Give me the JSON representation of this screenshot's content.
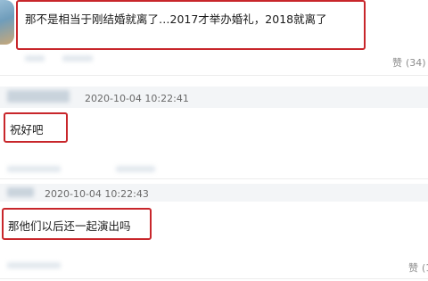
{
  "comments": [
    {
      "text": "那不是相当于刚结婚就离了…2017才举办婚礼，2018就离了",
      "like_icon": "thumbs-up-icon",
      "like_label": "赞",
      "like_count": "(34)"
    },
    {
      "timestamp": "2020-10-04  10:22:41",
      "text": "祝好吧"
    },
    {
      "timestamp": "2020-10-04  10:22:43",
      "text": "那他们以后还一起演出吗",
      "like_icon": "thumbs-up-icon",
      "like_label": "赞",
      "like_count": "(1"
    }
  ],
  "colors": {
    "highlight_border": "#c8262b",
    "timestamp_text": "#6a6a6a",
    "like_text": "#8c8c8c"
  }
}
